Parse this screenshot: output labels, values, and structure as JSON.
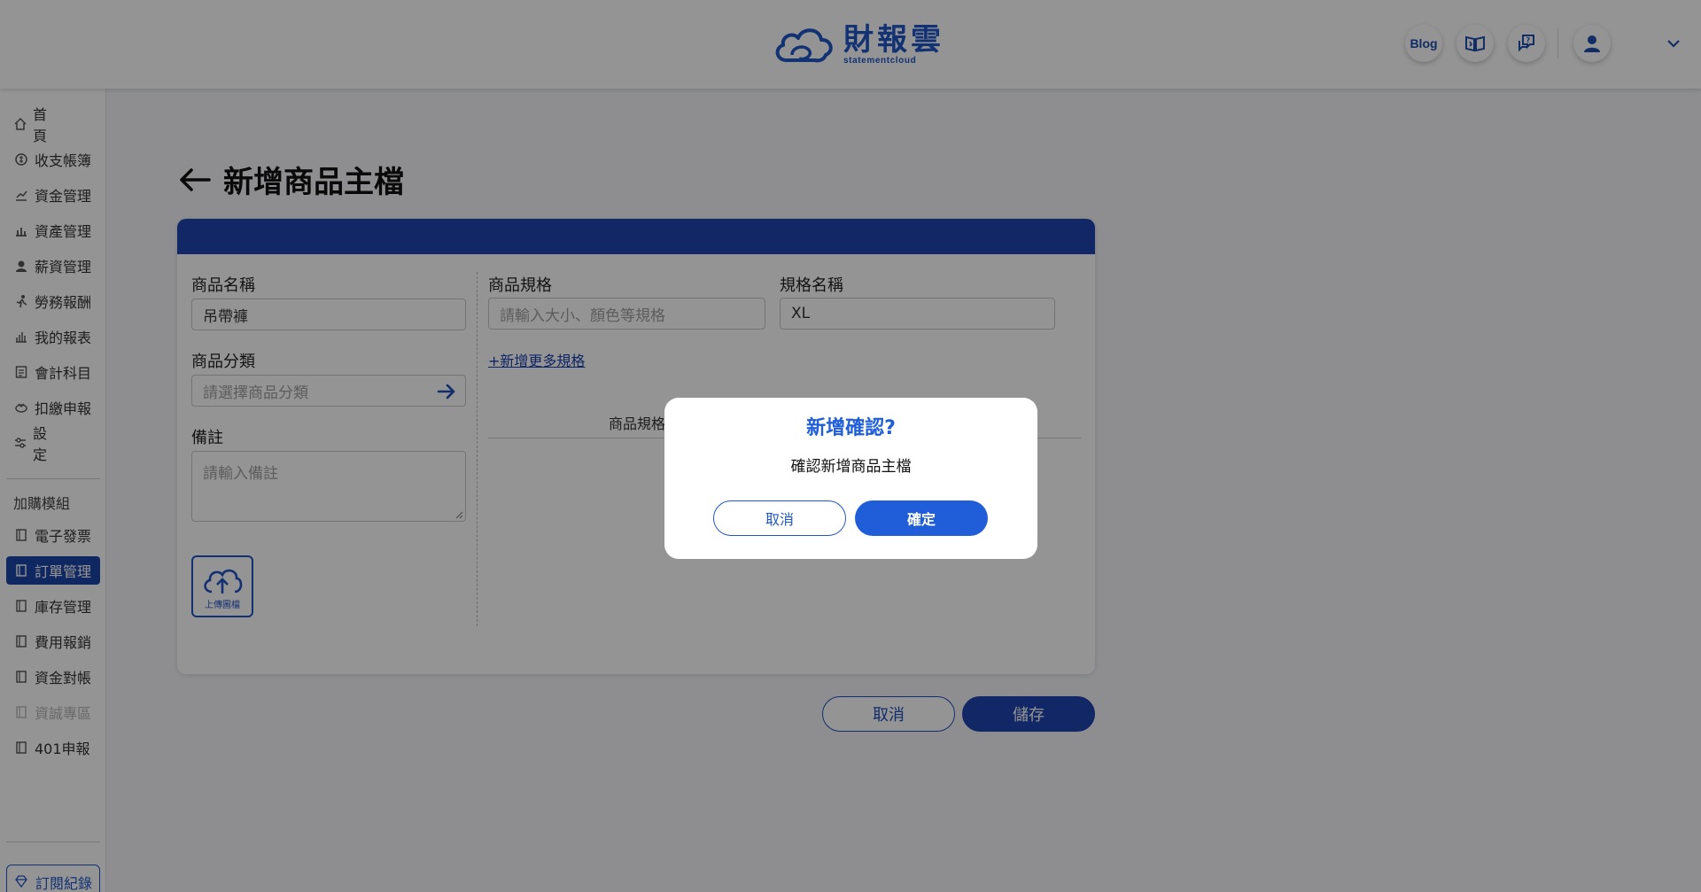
{
  "header": {
    "brand_name": "財報雲",
    "brand_sub": "statementcloud",
    "blog_label": "Blog"
  },
  "sidebar": {
    "items": [
      {
        "label": "首頁",
        "icon": "home-icon"
      },
      {
        "label": "收支帳簿",
        "icon": "money-icon"
      },
      {
        "label": "資金管理",
        "icon": "fund-icon"
      },
      {
        "label": "資產管理",
        "icon": "asset-icon"
      },
      {
        "label": "薪資管理",
        "icon": "salary-icon"
      },
      {
        "label": "勞務報酬",
        "icon": "labor-icon"
      },
      {
        "label": "我的報表",
        "icon": "report-icon"
      },
      {
        "label": "會計科目",
        "icon": "ledger-icon"
      },
      {
        "label": "扣繳申報",
        "icon": "tax-icon"
      },
      {
        "label": "設定",
        "icon": "settings-icon"
      }
    ],
    "addon_section_label": "加購模組",
    "addon_items": [
      {
        "label": "電子發票",
        "state": "normal"
      },
      {
        "label": "訂單管理",
        "state": "active"
      },
      {
        "label": "庫存管理",
        "state": "normal"
      },
      {
        "label": "費用報銷",
        "state": "normal"
      },
      {
        "label": "資金對帳",
        "state": "normal"
      },
      {
        "label": "資誠專區",
        "state": "disabled"
      },
      {
        "label": "401申報",
        "state": "normal"
      }
    ],
    "subscription_label": "訂閱紀錄"
  },
  "page": {
    "title": "新增商品主檔"
  },
  "form": {
    "product_name_label": "商品名稱",
    "product_name_value": "吊帶褲",
    "category_label": "商品分類",
    "category_placeholder": "請選擇商品分類",
    "note_label": "備註",
    "note_placeholder": "請輸入備註",
    "upload_label": "上傳圖檔",
    "spec_label": "商品規格",
    "spec_placeholder": "請輸入大小、顏色等規格",
    "spec_name_label": "規格名稱",
    "spec_name_value": "XL",
    "add_spec_link": "+新增更多規格",
    "table_col_spec": "商品規格"
  },
  "actions": {
    "cancel_label": "取消",
    "save_label": "儲存"
  },
  "modal": {
    "title": "新增確認?",
    "message": "確認新增商品主檔",
    "cancel_label": "取消",
    "confirm_label": "確定"
  },
  "colors": {
    "brand_blue": "#1f45b0",
    "accent_blue": "#1f5ed8"
  }
}
